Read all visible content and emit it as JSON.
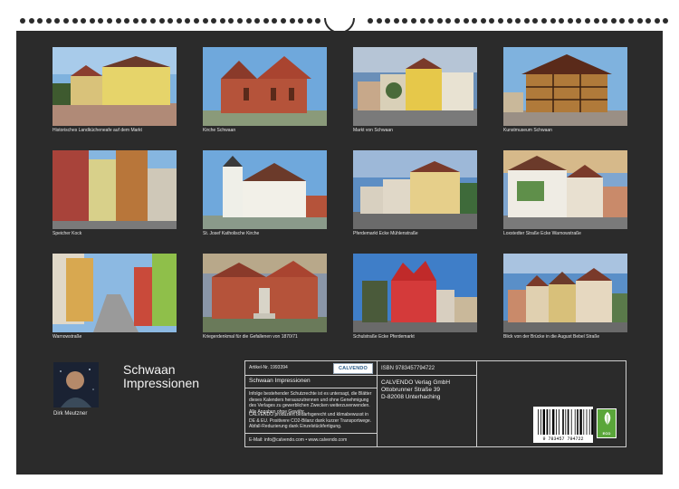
{
  "calendar": {
    "title_line1": "Schwaan",
    "title_line2": "Impressionen",
    "author": "Dirk Meutzner"
  },
  "photos": [
    {
      "caption": "Historisches Landkücheneafe auf dem Markt",
      "scene": "yellow-house-street"
    },
    {
      "caption": "Kirche Schwaan",
      "scene": "brick-church"
    },
    {
      "caption": "Markt von Schwaan",
      "scene": "market-square"
    },
    {
      "caption": "Kunstmuseum Schwaan",
      "scene": "half-timbered-house"
    },
    {
      "caption": "Speicher Kock",
      "scene": "narrow-street"
    },
    {
      "caption": "St. Josef Katholische Kirche",
      "scene": "white-church"
    },
    {
      "caption": "Pferdemarkt Ecke Mühlenstraße",
      "scene": "street-corner"
    },
    {
      "caption": "Loxstedter Straße Ecke Warnowstraße",
      "scene": "mural-house"
    },
    {
      "caption": "Warnowstraße",
      "scene": "cobbled-street"
    },
    {
      "caption": "Kriegerdenkmal für die Gefallenen von 1870/71",
      "scene": "monument"
    },
    {
      "caption": "Schulstraße Ecke Pferdemarkt",
      "scene": "red-gable-house"
    },
    {
      "caption": "Blick von der Brücke in die August Bebel Straße",
      "scene": "gabled-row"
    }
  ],
  "info": {
    "article_no": "Artikel-Nr. 1993394",
    "publisher_logo": "CALVENDO",
    "calendar_name": "Schwaan Impressionen",
    "legal_text": "Infolge bestehender Schutzrechte ist es untersagt, die Blätter dieses Kalenders herauszutrennen und ohne Genehmigung des Verlages zu gewerblichen Zwecken weiterzuverwenden. Alle Angaben ohne Gewähr.",
    "eco_text": "CALVENDO produziert bedarfsgerecht und klimabewusst in DE & EU. Positivere CO2-Bilanz dank kurzer Transportwege. Abfall-Reduzierung dank Einzelstückfertigung.",
    "contact": "E-Mail: info@calvendo.com • www.calvendo.com",
    "isbn": "ISBN 9783457794722",
    "publisher_name": "CALVENDO Verlag GmbH",
    "publisher_street": "Ottobrunner Straße 39",
    "publisher_city": "D-82008 Unterhaching",
    "barcode_digits": "9 783457 794722",
    "eco_badge": "ECO"
  }
}
